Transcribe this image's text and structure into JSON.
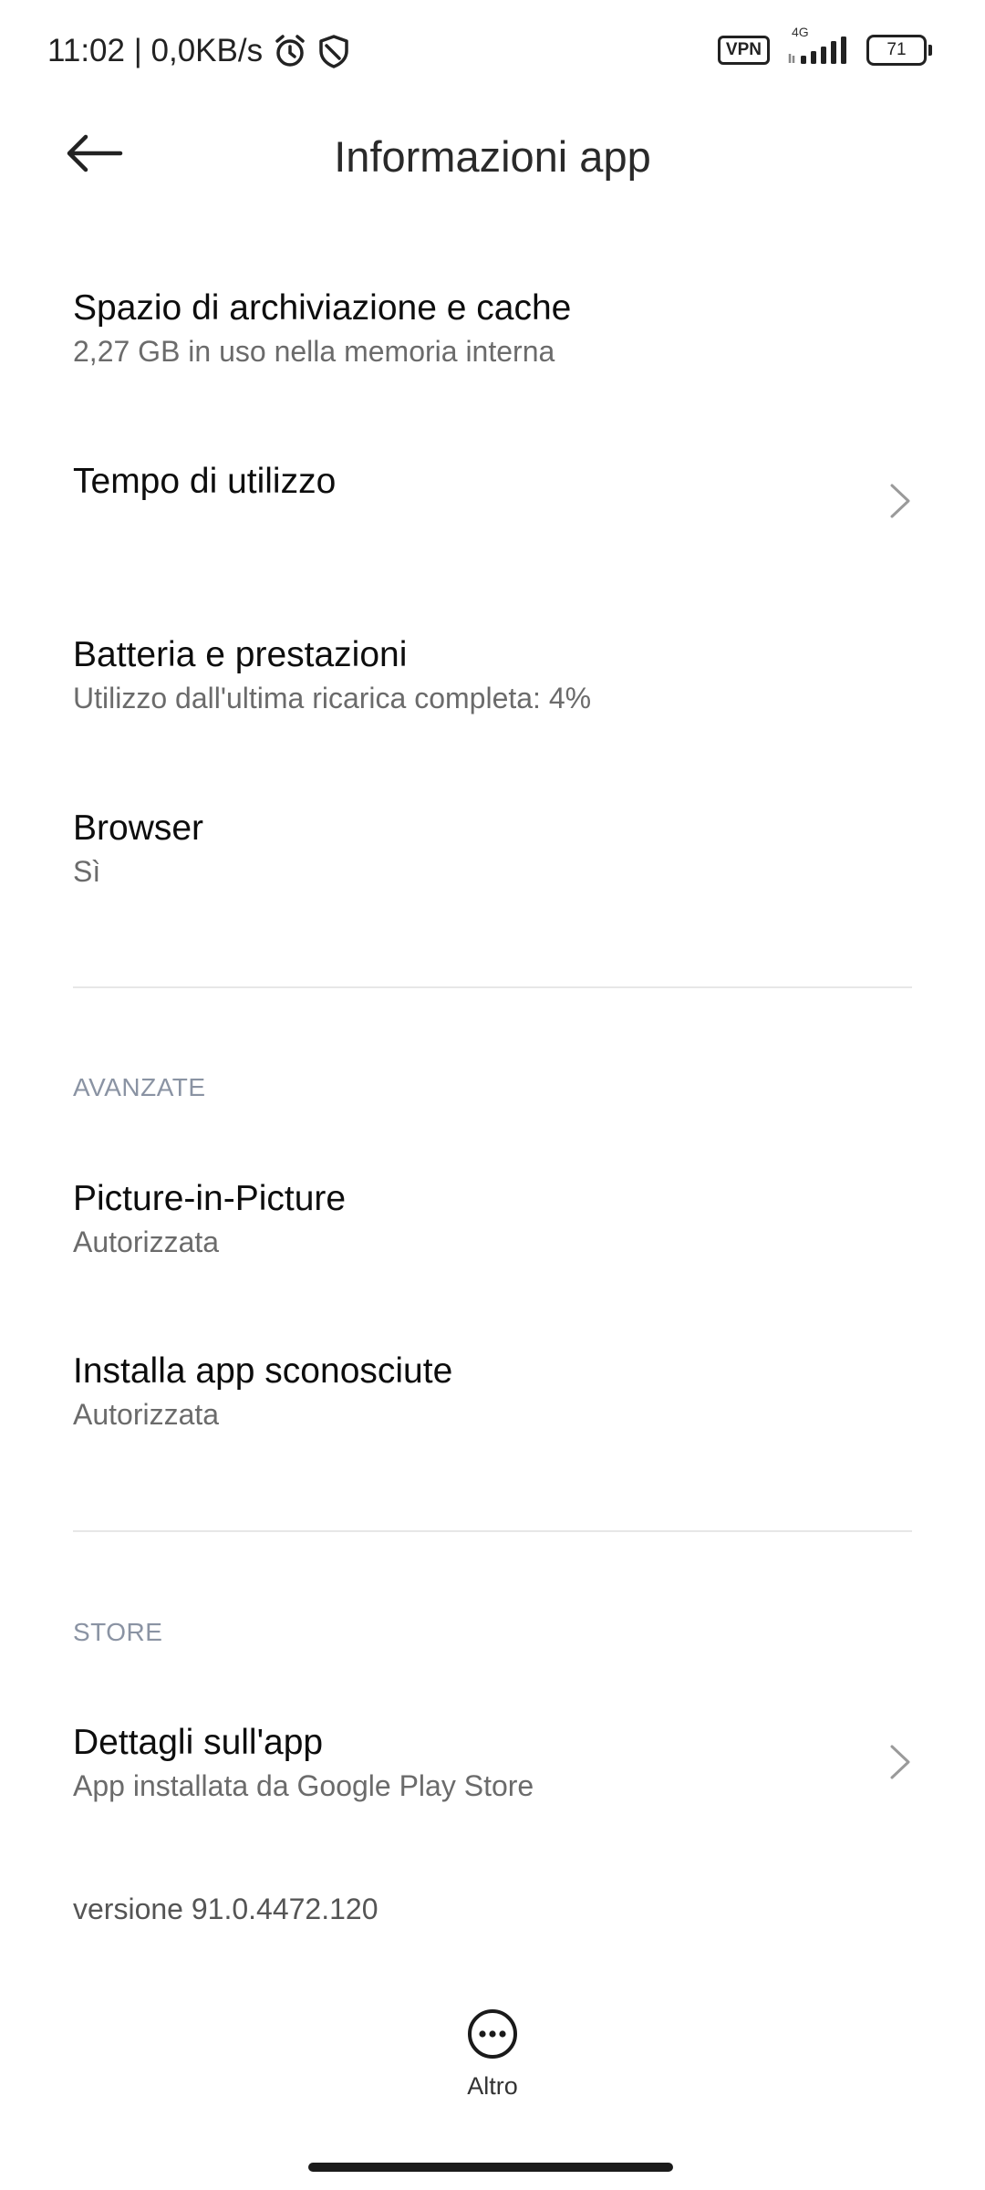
{
  "status_bar": {
    "time_speed": "11:02 | 0,0KB/s",
    "vpn": "VPN",
    "network_type": "4G",
    "battery": "71",
    "icons": [
      "alarm-icon",
      "shield-icon",
      "signal-icon"
    ]
  },
  "header": {
    "title": "Informazioni app",
    "back_icon": "arrow-left-icon"
  },
  "items": [
    {
      "title": "Spazio di archiviazione e cache",
      "subtitle": "2,27 GB in uso nella memoria interna"
    },
    {
      "title": "Tempo di utilizzo",
      "subtitle": ""
    },
    {
      "title": "Batteria e prestazioni",
      "subtitle": "Utilizzo dall'ultima ricarica completa: 4%"
    },
    {
      "title": "Browser",
      "subtitle": "Sì"
    }
  ],
  "advanced": {
    "header": "AVANZATE",
    "items": [
      {
        "title": "Picture-in-Picture",
        "subtitle": "Autorizzata"
      },
      {
        "title": "Installa app sconosciute",
        "subtitle": "Autorizzata"
      }
    ]
  },
  "store": {
    "header": "STORE",
    "items": [
      {
        "title": "Dettagli sull'app",
        "subtitle": "App installata da Google Play Store"
      }
    ]
  },
  "version": "versione 91.0.4472.120",
  "footer": {
    "more_label": "Altro",
    "more_icon": "more-horizontal-icon"
  },
  "colors": {
    "section_header": "#8a93a3",
    "subtitle": "#6b6b6b",
    "divider": "#e7e7e7"
  }
}
